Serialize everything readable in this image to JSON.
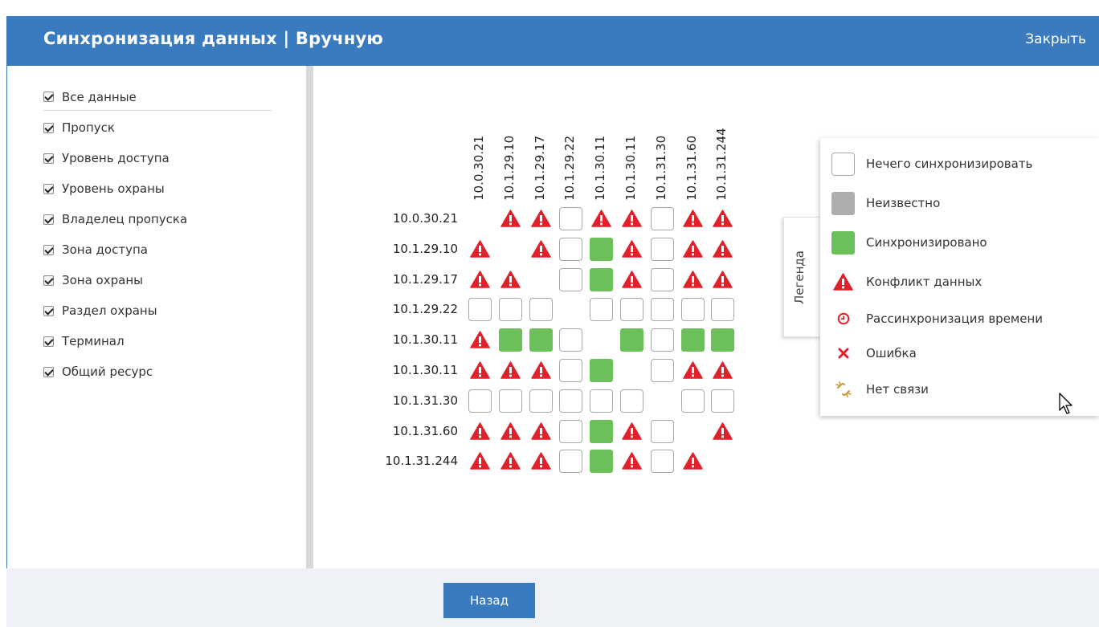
{
  "header": {
    "title": "Синхронизация данных | Вручную",
    "close_label": "Закрыть"
  },
  "filters": [
    {
      "label": "Все данные",
      "checked": true
    },
    {
      "label": "Пропуск",
      "checked": true
    },
    {
      "label": "Уровень доступа",
      "checked": true
    },
    {
      "label": "Уровень охраны",
      "checked": true
    },
    {
      "label": "Владелец пропуска",
      "checked": true
    },
    {
      "label": "Зона доступа",
      "checked": true
    },
    {
      "label": "Зона охраны",
      "checked": true
    },
    {
      "label": "Раздел охраны",
      "checked": true
    },
    {
      "label": "Терминал",
      "checked": true
    },
    {
      "label": "Общий ресурс",
      "checked": true
    }
  ],
  "matrix": {
    "columns": [
      "10.0.30.21",
      "10.1.29.10",
      "10.1.29.17",
      "10.1.29.22",
      "10.1.30.11",
      "10.1.30.11",
      "10.1.31.30",
      "10.1.31.60",
      "10.1.31.244"
    ],
    "rows": [
      {
        "label": "10.0.30.21",
        "cells": [
          "none",
          "conflict",
          "conflict",
          "nothing",
          "conflict",
          "conflict",
          "nothing",
          "conflict",
          "conflict"
        ]
      },
      {
        "label": "10.1.29.10",
        "cells": [
          "conflict",
          "none",
          "conflict",
          "nothing",
          "synced",
          "conflict",
          "nothing",
          "conflict",
          "conflict"
        ]
      },
      {
        "label": "10.1.29.17",
        "cells": [
          "conflict",
          "conflict",
          "none",
          "nothing",
          "synced",
          "conflict",
          "nothing",
          "conflict",
          "conflict"
        ]
      },
      {
        "label": "10.1.29.22",
        "cells": [
          "nothing",
          "nothing",
          "nothing",
          "none",
          "nothing",
          "nothing",
          "nothing",
          "nothing",
          "nothing"
        ]
      },
      {
        "label": "10.1.30.11",
        "cells": [
          "conflict",
          "synced",
          "synced",
          "nothing",
          "none",
          "synced",
          "nothing",
          "synced",
          "synced"
        ]
      },
      {
        "label": "10.1.30.11",
        "cells": [
          "conflict",
          "conflict",
          "conflict",
          "nothing",
          "synced",
          "none",
          "nothing",
          "conflict",
          "conflict"
        ]
      },
      {
        "label": "10.1.31.30",
        "cells": [
          "nothing",
          "nothing",
          "nothing",
          "nothing",
          "nothing",
          "nothing",
          "none",
          "nothing",
          "nothing"
        ]
      },
      {
        "label": "10.1.31.60",
        "cells": [
          "conflict",
          "conflict",
          "conflict",
          "nothing",
          "synced",
          "conflict",
          "nothing",
          "none",
          "conflict"
        ]
      },
      {
        "label": "10.1.31.244",
        "cells": [
          "conflict",
          "conflict",
          "conflict",
          "nothing",
          "synced",
          "conflict",
          "nothing",
          "conflict",
          "none"
        ]
      }
    ]
  },
  "legend": {
    "tab_label": "Легенда",
    "items": [
      {
        "kind": "nothing",
        "label": "Нечего синхронизировать"
      },
      {
        "kind": "unknown",
        "label": "Неизвестно"
      },
      {
        "kind": "synced",
        "label": "Синхронизировано"
      },
      {
        "kind": "conflict",
        "label": "Конфликт данных"
      },
      {
        "kind": "time",
        "label": "Рассинхронизация времени"
      },
      {
        "kind": "error",
        "label": "Ошибка"
      },
      {
        "kind": "nolink",
        "label": "Нет связи"
      }
    ]
  },
  "colors": {
    "accent": "#3a7bbf",
    "synced": "#6cbf5b",
    "unknown": "#aeaeae",
    "conflict": "#e2202a",
    "footer": "#eef1f6"
  },
  "footer": {
    "back_label": "Назад"
  }
}
